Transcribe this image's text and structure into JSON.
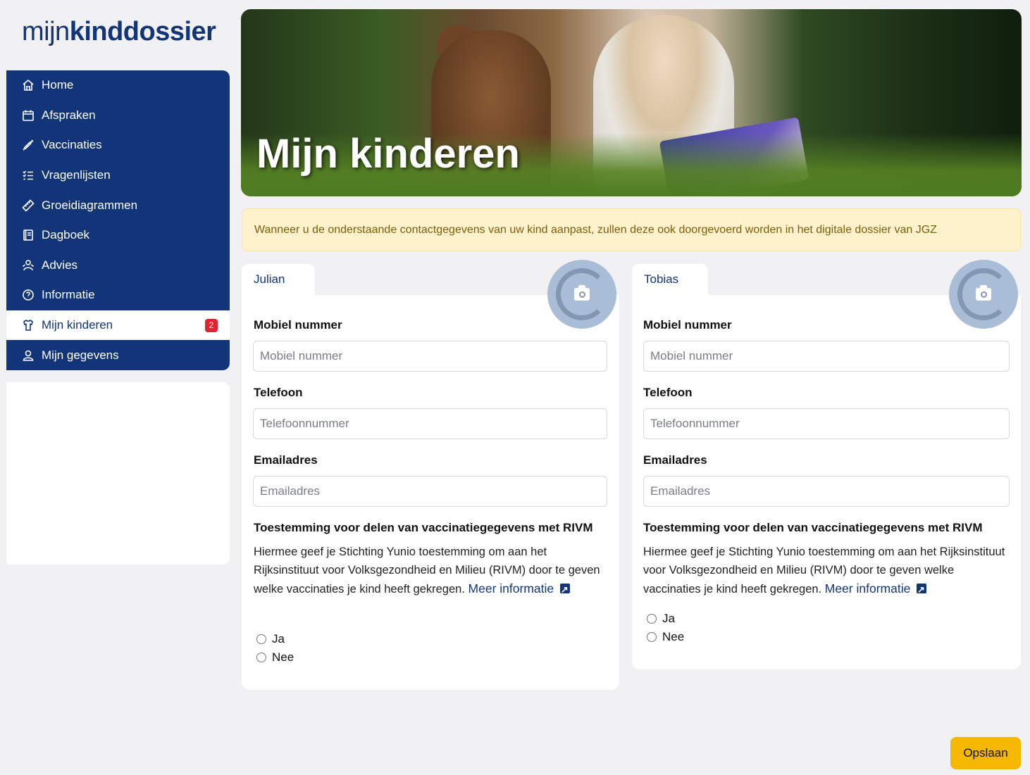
{
  "logo": {
    "light": "mijn",
    "bold": "kinddossier"
  },
  "sidebar": {
    "items": [
      {
        "label": "Home",
        "icon": "home-icon"
      },
      {
        "label": "Afspraken",
        "icon": "calendar-icon"
      },
      {
        "label": "Vaccinaties",
        "icon": "syringe-icon"
      },
      {
        "label": "Vragenlijsten",
        "icon": "checklist-icon"
      },
      {
        "label": "Groeidiagrammen",
        "icon": "ruler-icon"
      },
      {
        "label": "Dagboek",
        "icon": "journal-icon"
      },
      {
        "label": "Advies",
        "icon": "people-icon"
      },
      {
        "label": "Informatie",
        "icon": "question-icon"
      },
      {
        "label": "Mijn kinderen",
        "icon": "child-clothing-icon",
        "badge": "2",
        "active": true
      },
      {
        "label": "Mijn gegevens",
        "icon": "user-icon"
      }
    ]
  },
  "hero": {
    "title": "Mijn kinderen"
  },
  "notice": {
    "text": "Wanneer u de onderstaande contactgegevens van uw kind aanpast, zullen deze ook doorgevoerd worden in het digitale dossier van JGZ"
  },
  "children": [
    {
      "name": "Julian",
      "mobile_label": "Mobiel nummer",
      "mobile_placeholder": "Mobiel nummer",
      "phone_label": "Telefoon",
      "phone_placeholder": "Telefoonnummer",
      "email_label": "Emailadres",
      "email_placeholder": "Emailadres",
      "consent_title": "Toestemming voor delen van vaccinatiegegevens met RIVM",
      "consent_text": "Hiermee geef je Stichting Yunio toestemming om aan het Rijksinstituut voor Volksgezondheid en Milieu (RIVM) door te geven welke vaccinaties je kind heeft gekregen.",
      "more_info": "Meer informatie",
      "option_yes": "Ja",
      "option_no": "Nee"
    },
    {
      "name": "Tobias",
      "mobile_label": "Mobiel nummer",
      "mobile_placeholder": "Mobiel nummer",
      "phone_label": "Telefoon",
      "phone_placeholder": "Telefoonnummer",
      "email_label": "Emailadres",
      "email_placeholder": "Emailadres",
      "consent_title": "Toestemming voor delen van vaccinatiegegevens met RIVM",
      "consent_text": "Hiermee geef je Stichting Yunio toestemming om aan het Rijksinstituut voor Volksgezondheid en Milieu (RIVM) door te geven welke vaccinaties je kind heeft gekregen.",
      "more_info": "Meer informatie",
      "option_yes": "Ja",
      "option_no": "Nee"
    }
  ],
  "save_label": "Opslaan",
  "colors": {
    "brand": "#12357a",
    "accent": "#f5b800",
    "badge": "#e0232e",
    "notice_bg": "#fdf2cc"
  }
}
